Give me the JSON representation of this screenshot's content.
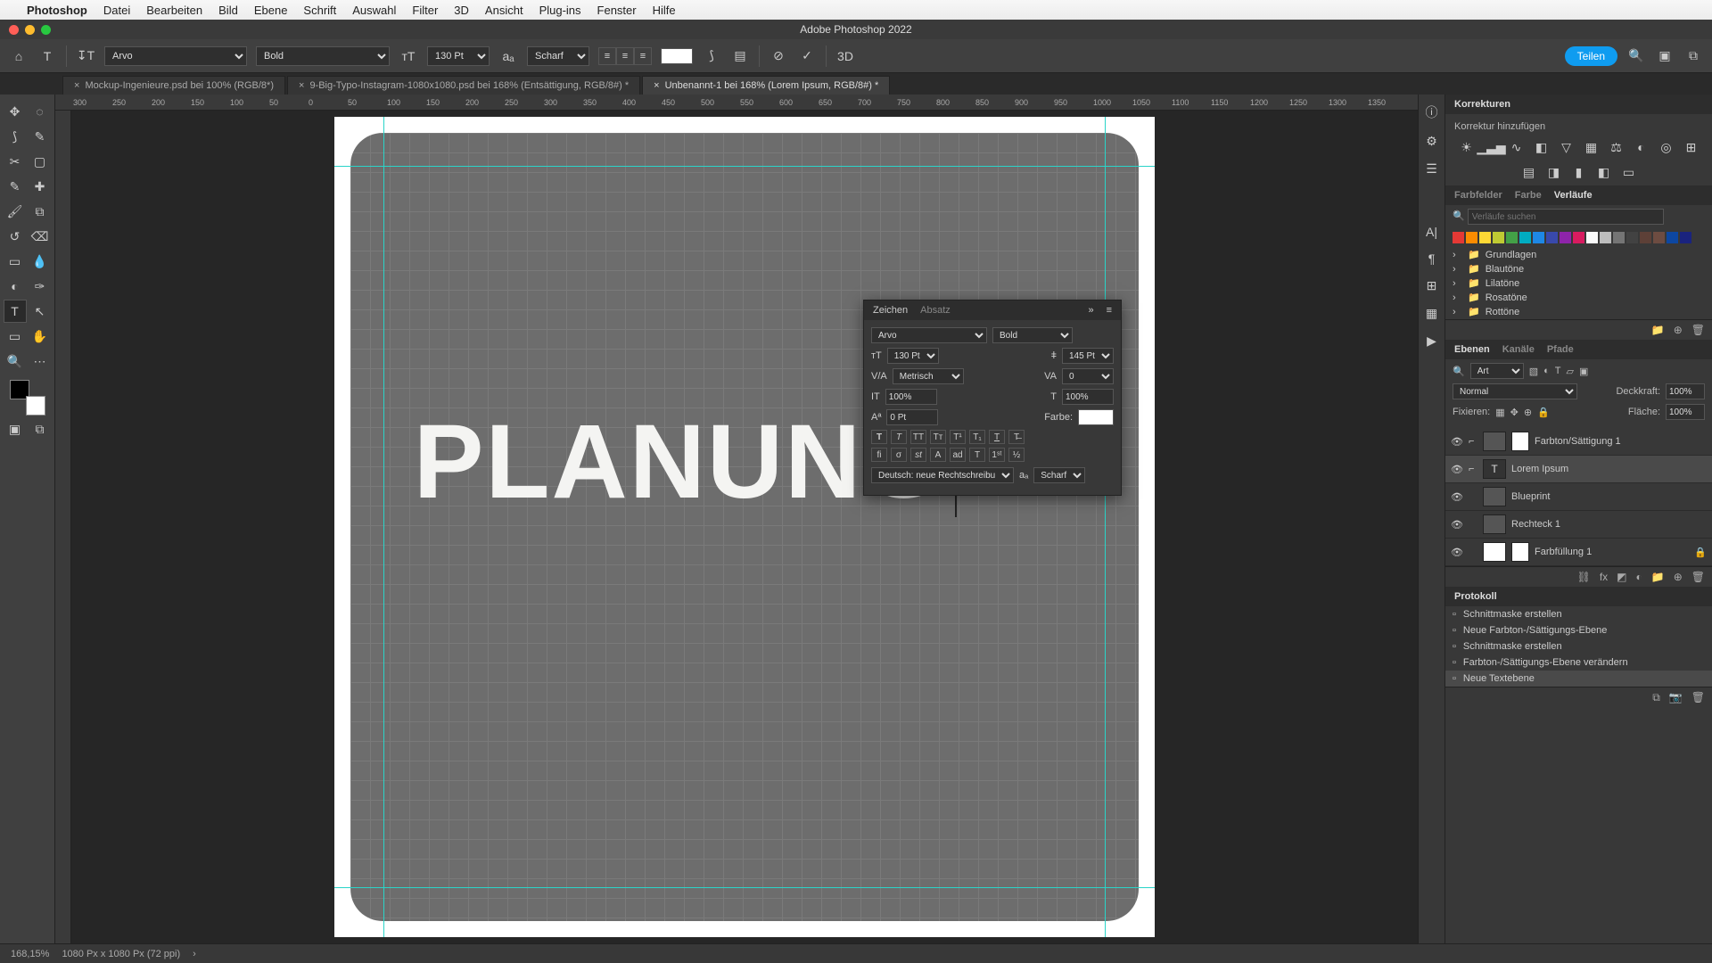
{
  "menubar": {
    "app": "Photoshop",
    "items": [
      "Datei",
      "Bearbeiten",
      "Bild",
      "Ebene",
      "Schrift",
      "Auswahl",
      "Filter",
      "3D",
      "Ansicht",
      "Plug-ins",
      "Fenster",
      "Hilfe"
    ]
  },
  "window_title": "Adobe Photoshop 2022",
  "optbar": {
    "font": "Arvo",
    "weight": "Bold",
    "size": "130 Pt",
    "aa": "Scharf",
    "share": "Teilen"
  },
  "tabs": [
    {
      "label": "Mockup-Ingenieure.psd bei 100% (RGB/8*)",
      "active": false
    },
    {
      "label": "9-Big-Typo-Instagram-1080x1080.psd bei 168% (Entsättigung, RGB/8#) *",
      "active": false
    },
    {
      "label": "Unbenannt-1 bei 168% (Lorem Ipsum, RGB/8#) *",
      "active": true
    }
  ],
  "ruler_marks": [
    "300",
    "250",
    "200",
    "150",
    "100",
    "50",
    "0",
    "50",
    "100",
    "150",
    "200",
    "250",
    "300",
    "350",
    "400",
    "450",
    "500",
    "550",
    "600",
    "650",
    "700",
    "750",
    "800",
    "850",
    "900",
    "950",
    "1000",
    "1050",
    "1100",
    "1150",
    "1200",
    "1250",
    "1300",
    "1350"
  ],
  "canvas_text": "PLANUNG",
  "charpanel": {
    "tabs": [
      "Zeichen",
      "Absatz"
    ],
    "font": "Arvo",
    "weight": "Bold",
    "size": "130 Pt",
    "leading": "145 Pt",
    "kerning": "Metrisch",
    "tracking": "0",
    "vscale": "100%",
    "hscale": "100%",
    "baseline": "0 Pt",
    "color_label": "Farbe:",
    "lang": "Deutsch: neue Rechtschreibu...",
    "aa": "Scharf"
  },
  "rightpanels": {
    "korrekturen": {
      "title": "Korrekturen",
      "add": "Korrektur hinzufügen"
    },
    "verlaufe": {
      "tabs": [
        "Farbfelder",
        "Farbe",
        "Verläufe"
      ],
      "search_ph": "Verläufe suchen",
      "folders": [
        "Grundlagen",
        "Blautöne",
        "Lilatöne",
        "Rosatöne",
        "Rottöne"
      ]
    },
    "ebenen": {
      "tabs": [
        "Ebenen",
        "Kanäle",
        "Pfade"
      ],
      "filter_ph": "Art",
      "blend": "Normal",
      "deck_label": "Deckkraft:",
      "deck": "100%",
      "fix_label": "Fixieren:",
      "flaeche_label": "Fläche:",
      "flaeche": "100%",
      "layers": [
        {
          "name": "Farbton/Sättigung 1",
          "type": "adj",
          "sel": false,
          "lock": false
        },
        {
          "name": "Lorem Ipsum",
          "type": "text",
          "sel": true,
          "lock": false
        },
        {
          "name": "Blueprint",
          "type": "img",
          "sel": false,
          "lock": false
        },
        {
          "name": "Rechteck 1",
          "type": "shape",
          "sel": false,
          "lock": false
        },
        {
          "name": "Farbfüllung 1",
          "type": "fill",
          "sel": false,
          "lock": true
        }
      ]
    },
    "protokoll": {
      "title": "Protokoll",
      "items": [
        "Schnittmaske erstellen",
        "Neue Farbton-/Sättigungs-Ebene",
        "Schnittmaske erstellen",
        "Farbton-/Sättigungs-Ebene verändern",
        "Neue Textebene"
      ]
    }
  },
  "status": {
    "zoom": "168,15%",
    "dims": "1080 Px x 1080 Px (72 ppi)"
  },
  "swatch_colors": [
    "#e53935",
    "#fb8c00",
    "#fdd835",
    "#c0ca33",
    "#43a047",
    "#00acc1",
    "#1e88e5",
    "#3949ab",
    "#8e24aa",
    "#d81b60",
    "#fafafa",
    "#bdbdbd",
    "#757575",
    "#424242",
    "#5d4037",
    "#6d4c41",
    "#0d47a1",
    "#1a237e"
  ]
}
